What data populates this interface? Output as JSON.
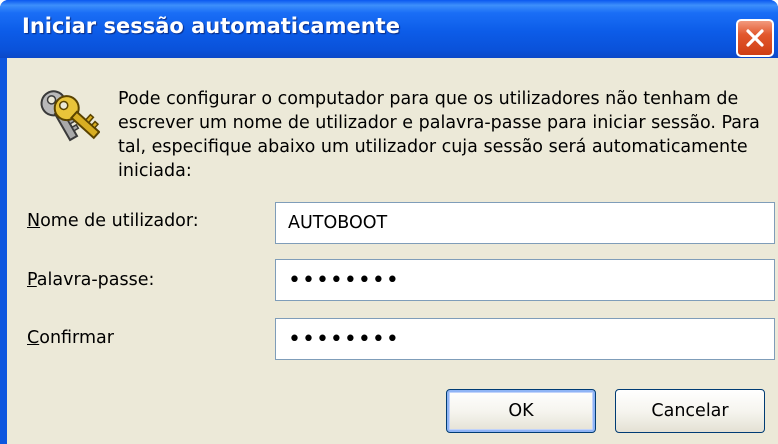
{
  "window": {
    "title": "Iniciar sessão automaticamente"
  },
  "description": "Pode configurar o computador para que os utilizadores não tenham de escrever um nome de utilizador e palavra-passe para iniciar sessão. Para tal, especifique abaixo um utilizador cuja sessão será automaticamente iniciada:",
  "form": {
    "username": {
      "label_mnemonic": "N",
      "label_rest": "ome de utilizador:",
      "value": "AUTOBOOT"
    },
    "password": {
      "label_mnemonic": "P",
      "label_rest": "alavra-passe:",
      "value": "••••••••"
    },
    "confirm": {
      "label_mnemonic": "C",
      "label_rest": "onfirmar",
      "value": "••••••••"
    }
  },
  "buttons": {
    "ok": "OK",
    "cancel": "Cancelar"
  },
  "icons": {
    "close": "close-icon",
    "keys": "keys-icon"
  },
  "colors": {
    "titlebar": "#0a52da",
    "client_background": "#ece9d8",
    "close_button": "#e2582d",
    "field_border": "#7f9db9",
    "button_border": "#003c74"
  }
}
